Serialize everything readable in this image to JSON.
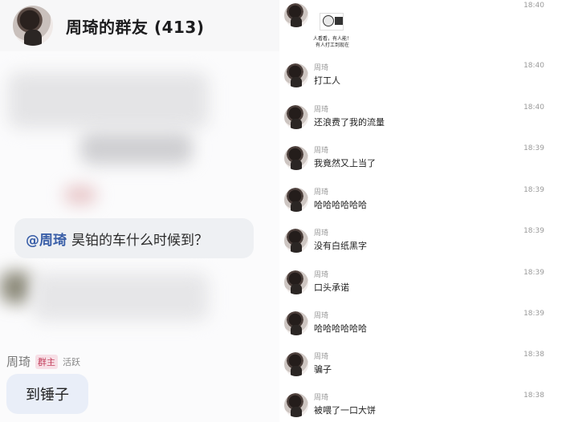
{
  "left": {
    "header_title": "周琦的群友 (413)",
    "mention_name": "@周琦",
    "mention_text": "昊铂的车什么时候到？",
    "sender_name": "周琦",
    "tag_owner": "群主",
    "tag_active": "活跃",
    "reply_text": "到锤子"
  },
  "right": {
    "sticker": {
      "caption_line1": "人看看，有人能！",
      "caption_line2": "有人打工到现在"
    },
    "messages": [
      {
        "name": "",
        "time": "18:40",
        "text": ""
      },
      {
        "name": "周琦",
        "time": "18:40",
        "text": "打工人"
      },
      {
        "name": "周琦",
        "time": "18:40",
        "text": "还浪费了我的流量"
      },
      {
        "name": "周琦",
        "time": "18:39",
        "text": "我竟然又上当了"
      },
      {
        "name": "周琦",
        "time": "18:39",
        "text": "哈哈哈哈哈哈"
      },
      {
        "name": "周琦",
        "time": "18:39",
        "text": "没有白纸黑字"
      },
      {
        "name": "周琦",
        "time": "18:39",
        "text": "口头承诺"
      },
      {
        "name": "周琦",
        "time": "18:39",
        "text": "哈哈哈哈哈哈"
      },
      {
        "name": "周琦",
        "time": "18:38",
        "text": "骗子"
      },
      {
        "name": "周琦",
        "time": "18:38",
        "text": "被喂了一口大饼"
      }
    ]
  }
}
